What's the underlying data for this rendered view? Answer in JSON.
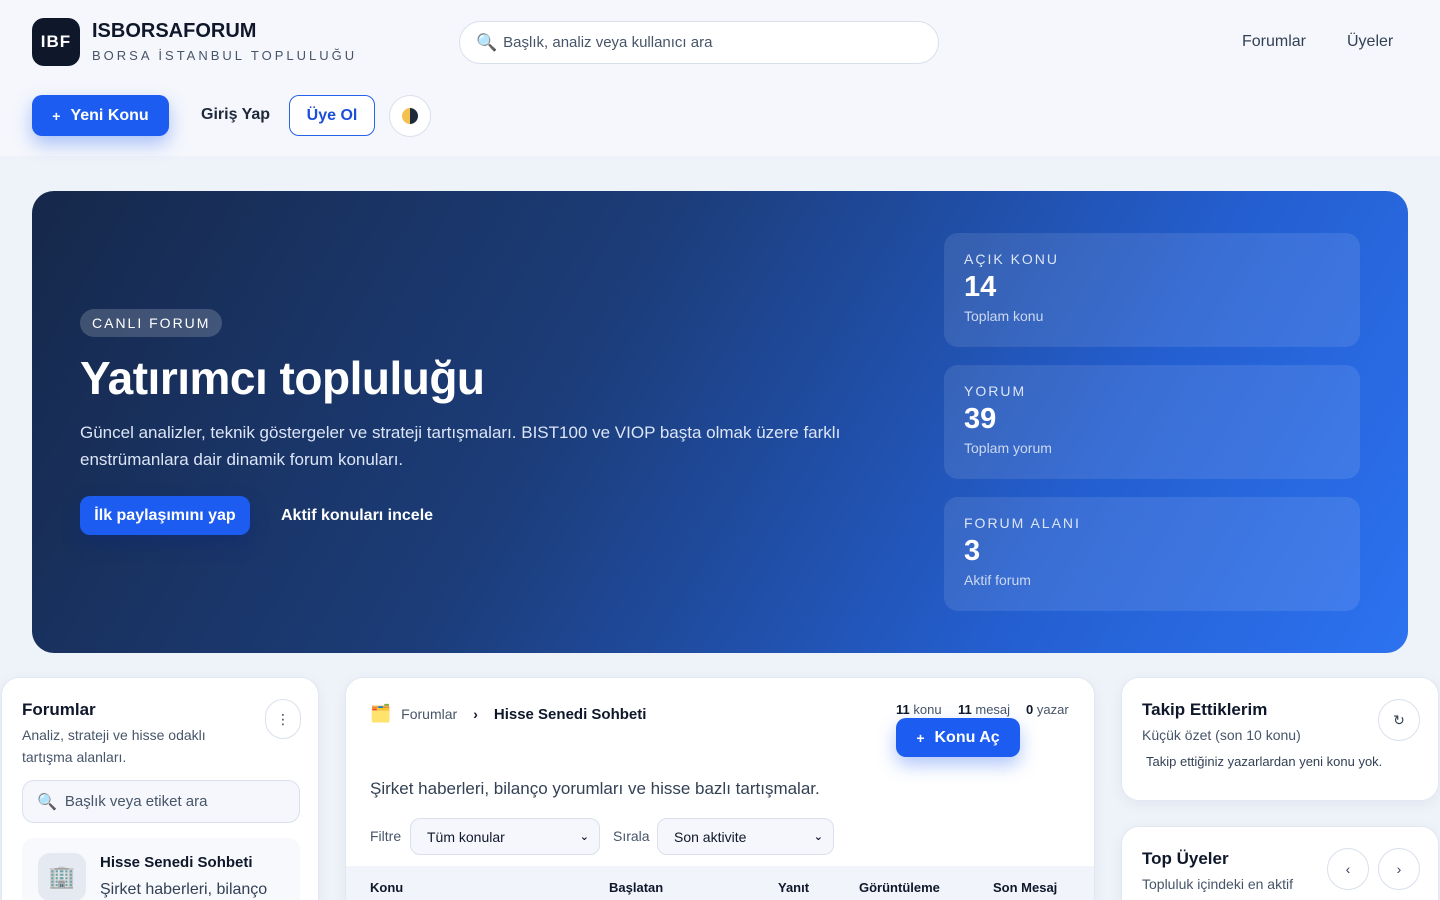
{
  "brand": {
    "logo": "IBF",
    "name": "ISBORSAFORUM",
    "subtitle": "BORSA İSTANBUL TOPLULUĞU"
  },
  "search": {
    "placeholder": "Başlık, analiz veya kullanıcı ara",
    "icon": "search-icon"
  },
  "nav": {
    "forums": "Forumlar",
    "members": "Üyeler"
  },
  "actions": {
    "new_topic": "Yeni Konu",
    "login": "Giriş Yap",
    "register": "Üye Ol",
    "theme_icon": "half-moon-icon"
  },
  "hero": {
    "badge": "CANLI FORUM",
    "title": "Yatırımcı topluluğu",
    "description": "Güncel analizler, teknik göstergeler ve strateji tartışmaları. BIST100 ve VIOP başta olmak üzere farklı enstrümanlara dair dinamik forum konuları.",
    "cta_primary": "İlk paylaşımını yap",
    "cta_secondary": "Aktif konuları incele",
    "stats": [
      {
        "label": "AÇIK KONU",
        "value": "14",
        "sub": "Toplam konu"
      },
      {
        "label": "YORUM",
        "value": "39",
        "sub": "Toplam yorum"
      },
      {
        "label": "FORUM ALANI",
        "value": "3",
        "sub": "Aktif forum"
      }
    ]
  },
  "sidebar": {
    "title": "Forumlar",
    "description": "Analiz, strateji ve hisse odaklı tartışma alanları.",
    "search_placeholder": "Başlık veya etiket ara",
    "items": [
      {
        "name": "Hisse Senedi Sohbeti",
        "desc": "Şirket haberleri, bilanço",
        "icon": "building-icon"
      }
    ]
  },
  "main": {
    "breadcrumb": {
      "root": "Forumlar",
      "current": "Hisse Senedi Sohbeti"
    },
    "meta": {
      "topics": "11",
      "topics_label": "konu",
      "messages": "11",
      "messages_label": "mesaj",
      "writers": "0",
      "writers_label": "yazar"
    },
    "open_topic": "Konu Aç",
    "description": "Şirket haberleri, bilanço yorumları ve hisse bazlı tartışmalar.",
    "filter_label": "Filtre",
    "filter_value": "Tüm konular",
    "sort_label": "Sırala",
    "sort_value": "Son aktivite",
    "columns": [
      "Konu",
      "Başlatan",
      "Yanıt",
      "Görüntüleme",
      "Son Mesaj"
    ]
  },
  "following": {
    "title": "Takip Ettiklerim",
    "description": "Küçük özet (son 10 konu)",
    "empty": "Takip ettiğiniz yazarlardan yeni konu yok."
  },
  "top_members": {
    "title": "Top Üyeler",
    "description": "Topluluk içindeki en aktif"
  }
}
